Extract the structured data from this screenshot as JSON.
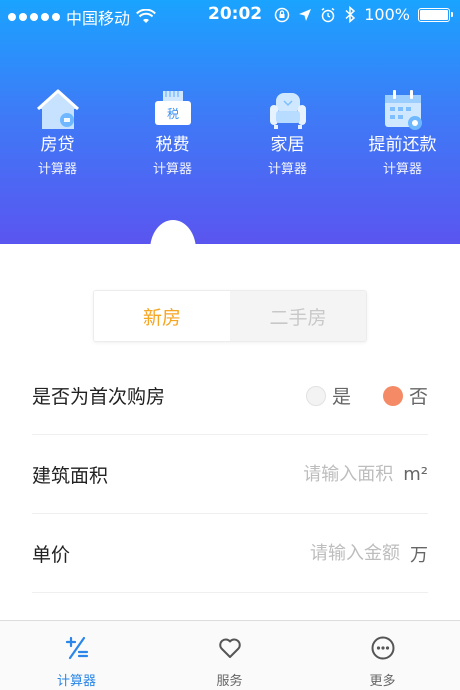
{
  "status_bar": {
    "carrier": "中国移动",
    "time": "20:02",
    "battery": "100%"
  },
  "calculators": [
    {
      "name": "房贷",
      "sub": "计算器",
      "icon": "house-loan-icon"
    },
    {
      "name": "税费",
      "sub": "计算器",
      "icon": "tax-icon",
      "badge": "税"
    },
    {
      "name": "家居",
      "sub": "计算器",
      "icon": "sofa-icon"
    },
    {
      "name": "提前还款",
      "sub": "计算器",
      "icon": "calendar-icon"
    }
  ],
  "segment": {
    "options": [
      "新房",
      "二手房"
    ],
    "selected": "新房"
  },
  "form": {
    "first_home": {
      "label": "是否为首次购房",
      "options": [
        "是",
        "否"
      ],
      "selected": "否"
    },
    "area": {
      "label": "建筑面积",
      "placeholder": "请输入面积",
      "unit": "m²"
    },
    "price": {
      "label": "单价",
      "placeholder": "请输入金额",
      "unit": "万"
    }
  },
  "tabbar": {
    "tabs": [
      {
        "label": "计算器",
        "icon": "calculator-icon",
        "active": true
      },
      {
        "label": "服务",
        "icon": "heart-icon",
        "active": false
      },
      {
        "label": "更多",
        "icon": "more-icon",
        "active": false
      }
    ]
  },
  "colors": {
    "accent": "#f5a623",
    "tab_active": "#2a86e8",
    "radio_on": "#f58a66",
    "hero_top": "#1aa3ff",
    "hero_bottom": "#5a55f0"
  }
}
